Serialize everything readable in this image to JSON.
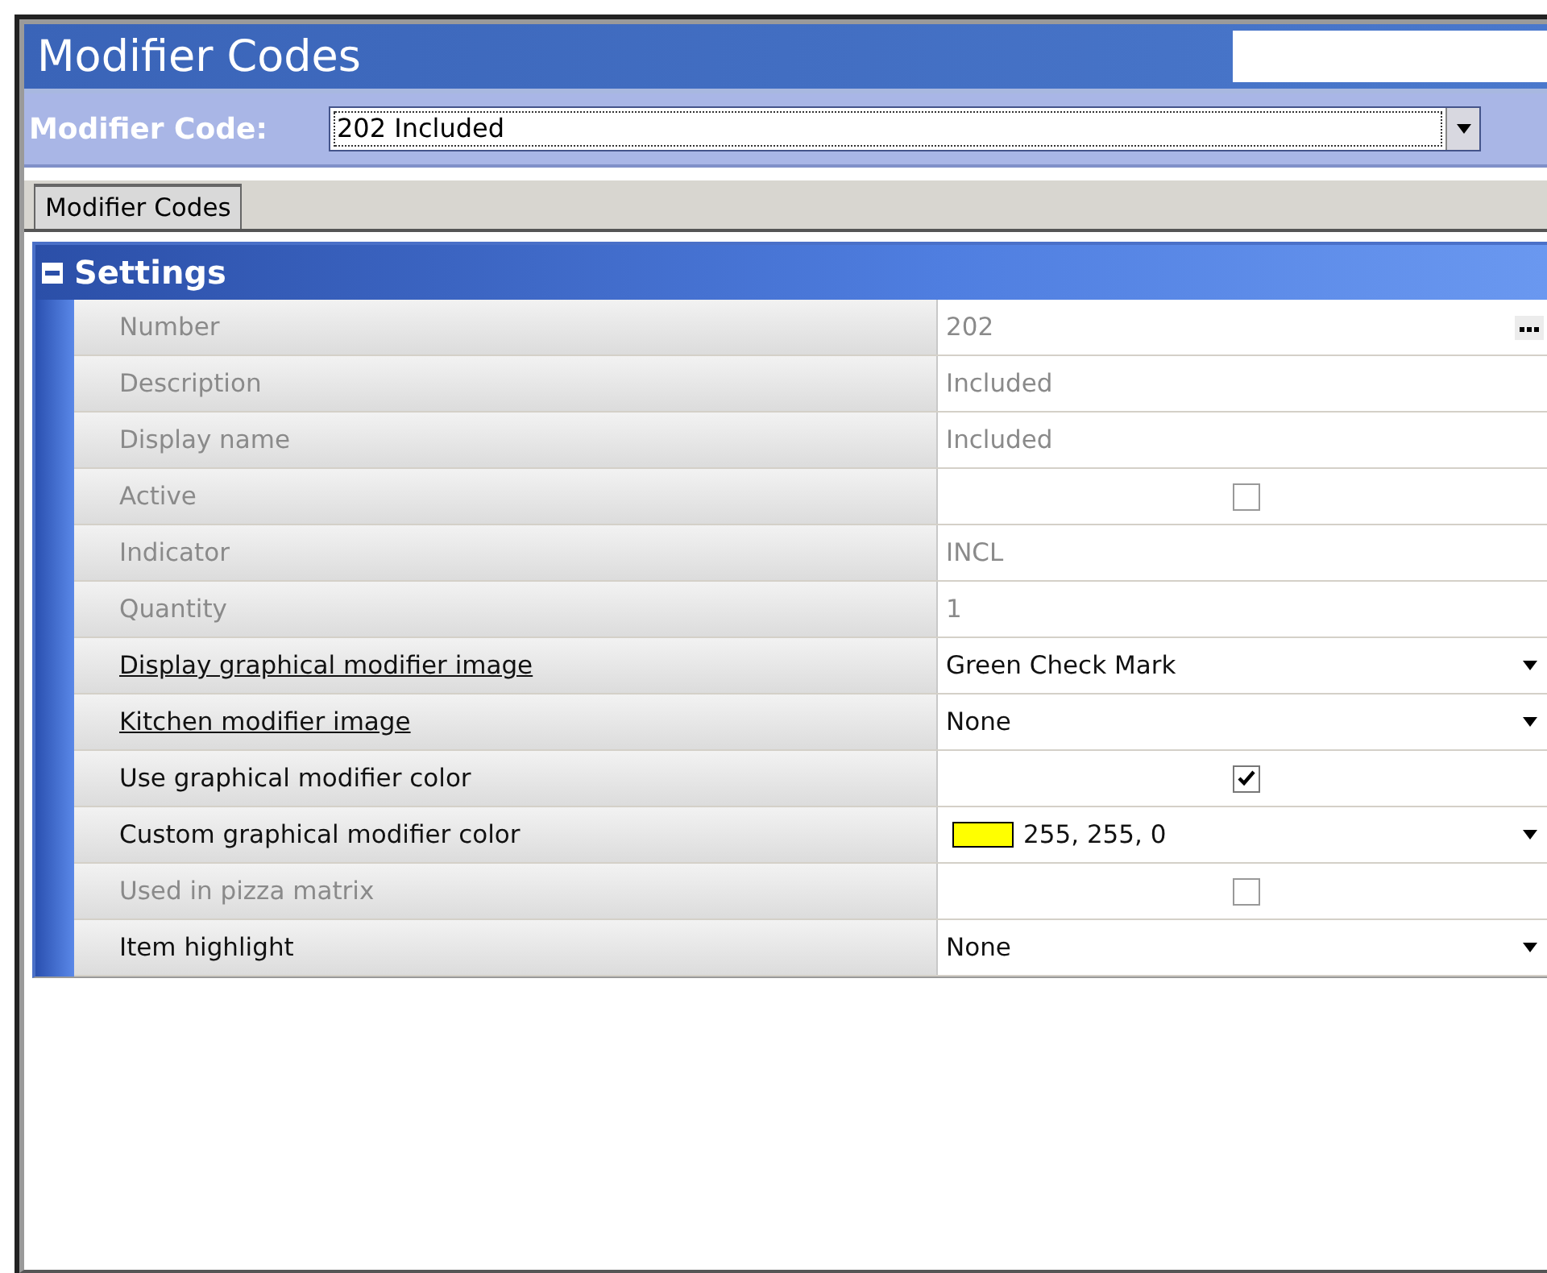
{
  "window": {
    "title": "Modifier Codes"
  },
  "selector": {
    "label": "Modifier Code:",
    "value": "202 Included"
  },
  "tabs": [
    {
      "label": "Modifier Codes",
      "selected": true
    }
  ],
  "section": {
    "title": "Settings",
    "expanded": true
  },
  "rows": [
    {
      "kind": "text",
      "label": "Number",
      "value": "202",
      "disabled": true,
      "underlined": false,
      "ellipsis": true
    },
    {
      "kind": "text",
      "label": "Description",
      "value": "Included",
      "disabled": true,
      "underlined": false
    },
    {
      "kind": "text",
      "label": "Display name",
      "value": "Included",
      "disabled": true,
      "underlined": false
    },
    {
      "kind": "checkbox",
      "label": "Active",
      "checked": false,
      "disabled": true,
      "underlined": false
    },
    {
      "kind": "text",
      "label": "Indicator",
      "value": "INCL",
      "disabled": true,
      "underlined": false
    },
    {
      "kind": "text",
      "label": "Quantity",
      "value": "1",
      "disabled": true,
      "underlined": false
    },
    {
      "kind": "dropdown",
      "label": "Display graphical modifier image",
      "value": "Green Check Mark",
      "disabled": false,
      "underlined": true
    },
    {
      "kind": "dropdown",
      "label": "Kitchen modifier image",
      "value": "None",
      "disabled": false,
      "underlined": true
    },
    {
      "kind": "checkbox",
      "label": "Use graphical modifier color",
      "checked": true,
      "disabled": false,
      "underlined": false
    },
    {
      "kind": "color",
      "label": "Custom graphical modifier color",
      "value": "255, 255, 0",
      "color": "#ffff00",
      "disabled": false,
      "underlined": false
    },
    {
      "kind": "checkbox",
      "label": "Used in pizza matrix",
      "checked": false,
      "disabled": true,
      "underlined": false
    },
    {
      "kind": "dropdown",
      "label": "Item highlight",
      "value": "None",
      "disabled": false,
      "underlined": false
    }
  ]
}
